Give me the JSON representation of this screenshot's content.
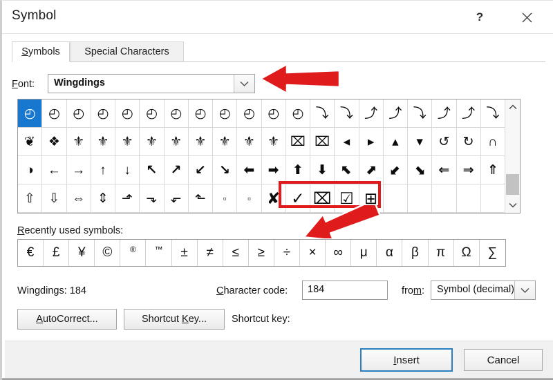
{
  "window": {
    "title": "Symbol",
    "help_icon": "question-mark-icon",
    "close_icon": "close-icon"
  },
  "tabs": [
    {
      "label": "Symbols",
      "active": true
    },
    {
      "label": "Special Characters",
      "active": false
    }
  ],
  "font_row": {
    "label": "Font:",
    "value": "Wingdings",
    "dropdown_icon": "chevron-down-icon"
  },
  "symbol_grid": {
    "columns": 20,
    "rows": 4,
    "selected_index": 0,
    "highlight_indices": [
      71,
      72,
      73,
      74
    ],
    "cells": [
      "◴",
      "◴",
      "◴",
      "◴",
      "◴",
      "◴",
      "◴",
      "◴",
      "◴",
      "◴",
      "◴",
      "◴",
      "⤵",
      "⤵",
      "⤴",
      "⤴",
      "⤵",
      "⤴",
      "⤴",
      "⤵",
      "❦",
      "❖",
      "⚜",
      "⚜",
      "⚜",
      "⚜",
      "⚜",
      "⚜",
      "⚜",
      "⚜",
      "⚜",
      "⌧",
      "⌧",
      "◂",
      "▸",
      "▴",
      "▾",
      "↺",
      "↻",
      "∩",
      "◑",
      "←",
      "→",
      "↑",
      "↓",
      "↖",
      "↗",
      "↙",
      "↘",
      "⬅",
      "➡",
      "⬆",
      "⬇",
      "⬉",
      "⬈",
      "⬋",
      "⬊",
      "⇐",
      "⇒",
      "⇑",
      "⇧",
      "⇩",
      "⇔",
      "⇕",
      "⬏",
      "⬎",
      "⬐",
      "⬑",
      "▫",
      "▫",
      "✘",
      "✓",
      "⌧",
      "☑",
      "⊞",
      "",
      "",
      "",
      "",
      ""
    ]
  },
  "scrollbar": {
    "up_icon": "chevron-up-icon",
    "down_icon": "chevron-down-icon"
  },
  "recent": {
    "label": "Recently used symbols:",
    "symbols": [
      "€",
      "£",
      "¥",
      "©",
      "®",
      "™",
      "±",
      "≠",
      "≤",
      "≥",
      "÷",
      "×",
      "∞",
      "μ",
      "α",
      "β",
      "π",
      "Ω",
      "∑"
    ]
  },
  "code_row": {
    "current_font_code": "Wingdings: 184",
    "char_code_label": "Character code:",
    "char_code_value": "184",
    "from_label": "from:",
    "from_value": "Symbol (decimal)",
    "from_dropdown_icon": "chevron-down-icon"
  },
  "action_row": {
    "autocorrect_label": "AutoCorrect...",
    "shortcut_key_button": "Shortcut Key...",
    "shortcut_key_label": "Shortcut key:"
  },
  "footer": {
    "insert_label": "Insert",
    "cancel_label": "Cancel"
  },
  "annotations": {
    "arrow_color": "#e01b1b",
    "highlight_color": "#e01b1b",
    "arrow_font_name": "red-arrow-pointing-to-font-dropdown",
    "arrow_symbol_name": "red-arrow-pointing-to-checkbox-symbols"
  }
}
